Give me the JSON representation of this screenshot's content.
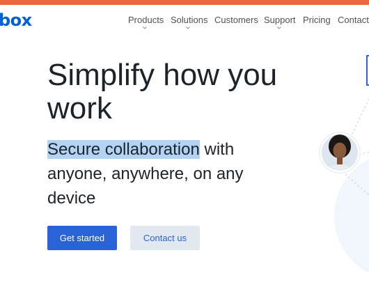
{
  "brand": {
    "logo_text": "box",
    "accent_color": "#e8693c",
    "logo_color": "#0061d5"
  },
  "nav": {
    "items": [
      {
        "label": "Products",
        "has_dropdown": true
      },
      {
        "label": "Solutions",
        "has_dropdown": true
      },
      {
        "label": "Customers",
        "has_dropdown": false
      },
      {
        "label": "Support",
        "has_dropdown": true
      },
      {
        "label": "Pricing",
        "has_dropdown": false
      },
      {
        "label": "Contact",
        "has_dropdown": false
      }
    ],
    "chevron_icon": "chevron-down-icon"
  },
  "hero": {
    "title": "Simplify how you work",
    "subtitle_selected": "Secure collaboration",
    "subtitle_rest": " with anyone, anywhere, on any device",
    "primary_button": "Get started",
    "secondary_button": "Contact us",
    "selection_color": "#b3d3f5",
    "primary_color": "#2a62d7"
  },
  "illustration": {
    "avatar_icon": "person-avatar-icon"
  }
}
